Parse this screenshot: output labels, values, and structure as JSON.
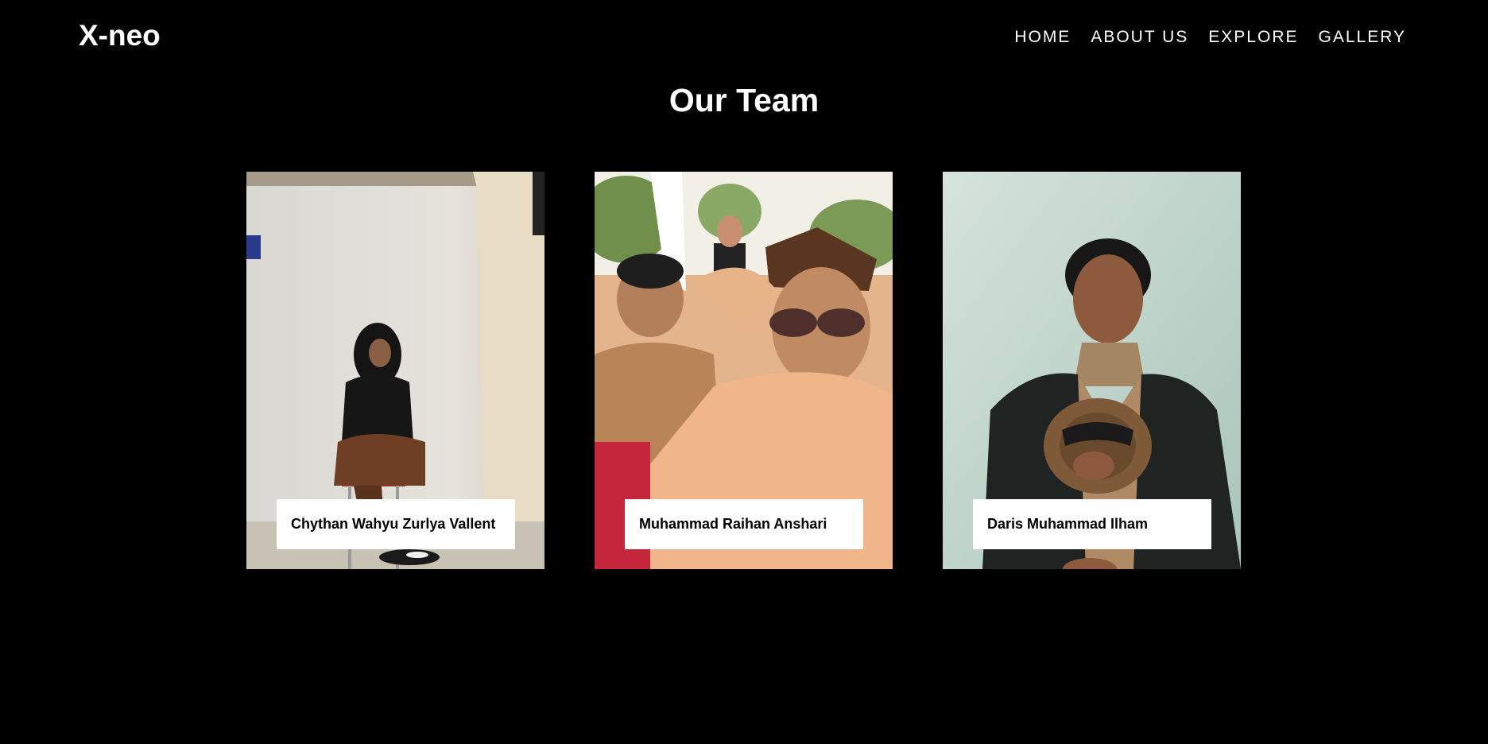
{
  "header": {
    "logo": "X-neo",
    "nav": [
      "HOME",
      "ABOUT US",
      "EXPLORE",
      "GALLERY"
    ]
  },
  "main": {
    "title": "Our Team",
    "members": [
      {
        "name": "Chythan Wahyu Zurlya Vallent"
      },
      {
        "name": "Muhammad Raihan Anshari"
      },
      {
        "name": "Daris Muhammad Ilham"
      }
    ]
  },
  "colors": {
    "background": "#000000",
    "text": "#ffffff",
    "name_box": "#ffffff"
  }
}
